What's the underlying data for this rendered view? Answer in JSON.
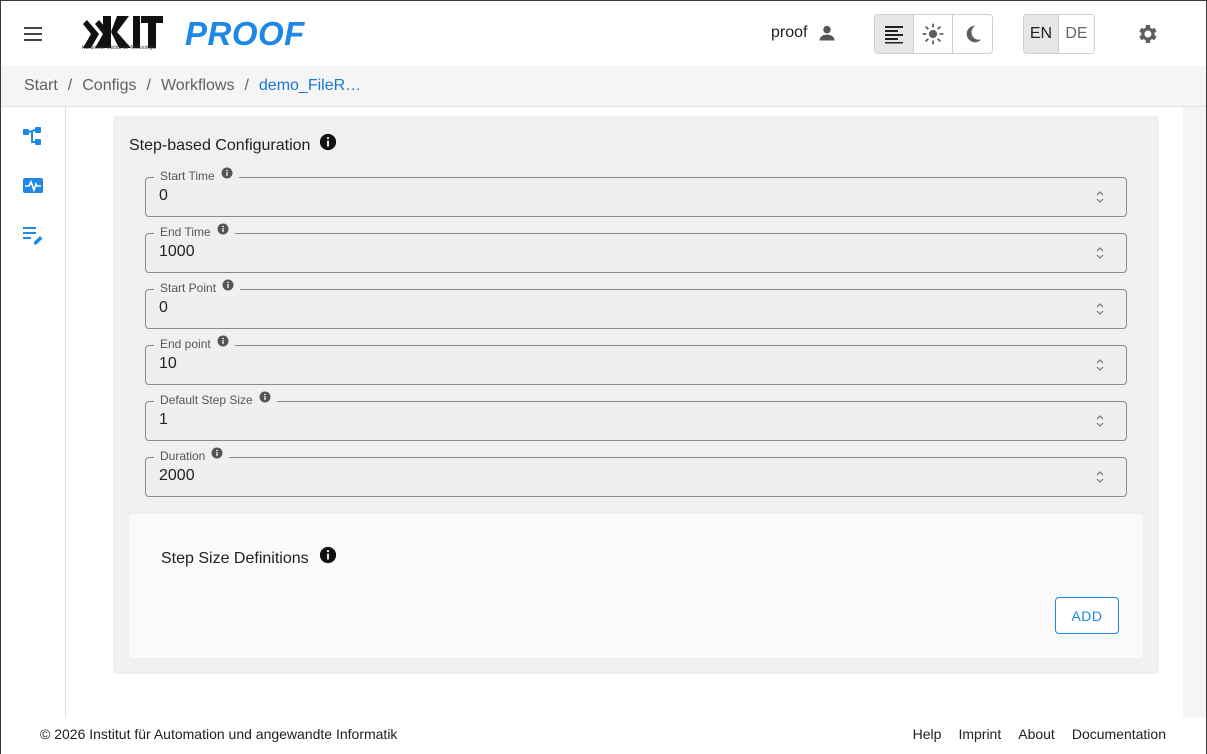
{
  "header": {
    "menu_icon": "hamburger-menu-icon",
    "logo_text": "KIT",
    "logo_subtitle": "Karlsruher Institut für Technologie",
    "app_title": "PROOF",
    "user_name": "proof",
    "theme_options": [
      "text-align-icon",
      "sun-icon",
      "moon-icon"
    ],
    "languages": [
      "EN",
      "DE"
    ],
    "active_language": "EN",
    "settings_icon": "gear-icon"
  },
  "breadcrumb": {
    "items": [
      "Start",
      "Configs",
      "Workflows"
    ],
    "current": "demo_FileR…",
    "separator": "/"
  },
  "sidebar": {
    "items": [
      "workflow-tree-icon",
      "monitor-pulse-icon",
      "edit-list-icon"
    ]
  },
  "config": {
    "title": "Step-based Configuration",
    "fields": [
      {
        "label": "Start Time",
        "value": "0"
      },
      {
        "label": "End Time",
        "value": "1000"
      },
      {
        "label": "Start Point",
        "value": "0"
      },
      {
        "label": "End point",
        "value": "10"
      },
      {
        "label": "Default Step Size",
        "value": "1"
      },
      {
        "label": "Duration",
        "value": "2000"
      }
    ]
  },
  "step_sizes": {
    "title": "Step Size Definitions",
    "add_label": "ADD"
  },
  "footer": {
    "copyright": "© 2026 Institut für Automation und angewandte Informatik",
    "links": [
      "Help",
      "Imprint",
      "About",
      "Documentation"
    ]
  },
  "colors": {
    "accent": "#1e88e5",
    "panel_bg": "#f0f0f0",
    "subpanel_bg": "#fafafa"
  }
}
